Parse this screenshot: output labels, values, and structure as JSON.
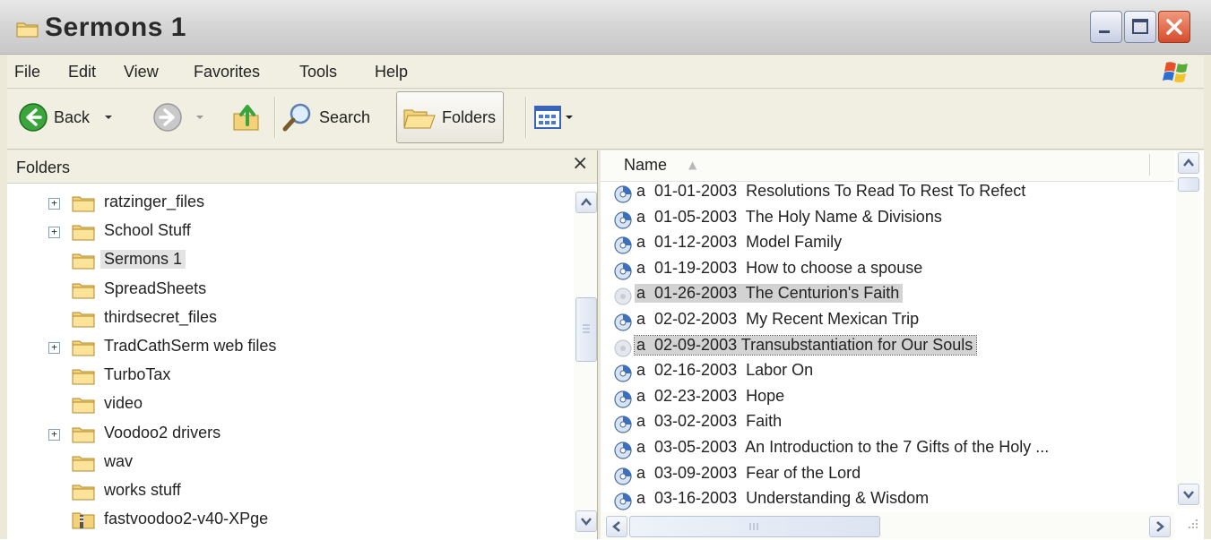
{
  "window": {
    "title": "Sermons 1",
    "buttons": {
      "minimize": "minimize",
      "maximize": "maximize",
      "close": "close"
    }
  },
  "menu": [
    "File",
    "Edit",
    "View",
    "Favorites",
    "Tools",
    "Help"
  ],
  "toolbar": {
    "back_label": "Back",
    "search_label": "Search",
    "folders_label": "Folders"
  },
  "folders_pane": {
    "title": "Folders",
    "close_glyph": "×",
    "items": [
      {
        "label": "ratzinger_files",
        "expandable": true,
        "selected": false
      },
      {
        "label": "School Stuff",
        "expandable": true,
        "selected": false
      },
      {
        "label": "Sermons 1",
        "expandable": false,
        "selected": true
      },
      {
        "label": "SpreadSheets",
        "expandable": false,
        "selected": false
      },
      {
        "label": "thirdsecret_files",
        "expandable": false,
        "selected": false
      },
      {
        "label": "TradCathSerm web files",
        "expandable": true,
        "selected": false
      },
      {
        "label": "TurboTax",
        "expandable": false,
        "selected": false
      },
      {
        "label": "video",
        "expandable": false,
        "selected": false
      },
      {
        "label": "Voodoo2 drivers",
        "expandable": true,
        "selected": false
      },
      {
        "label": "wav",
        "expandable": false,
        "selected": false
      },
      {
        "label": "works stuff",
        "expandable": false,
        "selected": false
      },
      {
        "label": "fastvoodoo2-v40-XPge",
        "expandable": false,
        "selected": false
      }
    ]
  },
  "file_list": {
    "column_name": "Name",
    "sort_glyph": "▲",
    "files": [
      {
        "label": "a  01-01-2003  Resolutions To Read To Rest To Refect",
        "state": "normal"
      },
      {
        "label": "a  01-05-2003  The Holy Name & Divisions",
        "state": "normal"
      },
      {
        "label": "a  01-12-2003  Model Family",
        "state": "normal"
      },
      {
        "label": "a  01-19-2003  How to choose a spouse",
        "state": "normal"
      },
      {
        "label": "a  01-26-2003  The Centurion's Faith",
        "state": "selected"
      },
      {
        "label": "a  02-02-2003  My Recent Mexican Trip",
        "state": "normal"
      },
      {
        "label": "a  02-09-2003 Transubstantiation for Our Souls",
        "state": "focused"
      },
      {
        "label": "a  02-16-2003  Labor On",
        "state": "normal"
      },
      {
        "label": "a  02-23-2003  Hope",
        "state": "normal"
      },
      {
        "label": "a  03-02-2003  Faith",
        "state": "normal"
      },
      {
        "label": "a  03-05-2003  An Introduction to the 7 Gifts of the Holy ...",
        "state": "normal"
      },
      {
        "label": "a  03-09-2003  Fear of the Lord",
        "state": "normal"
      },
      {
        "label": "a  03-16-2003  Understanding & Wisdom",
        "state": "normal"
      }
    ]
  },
  "colors": {
    "chrome": "#ece9d8",
    "selection": "#d3d3d3",
    "close_button": "#d64c2c"
  }
}
